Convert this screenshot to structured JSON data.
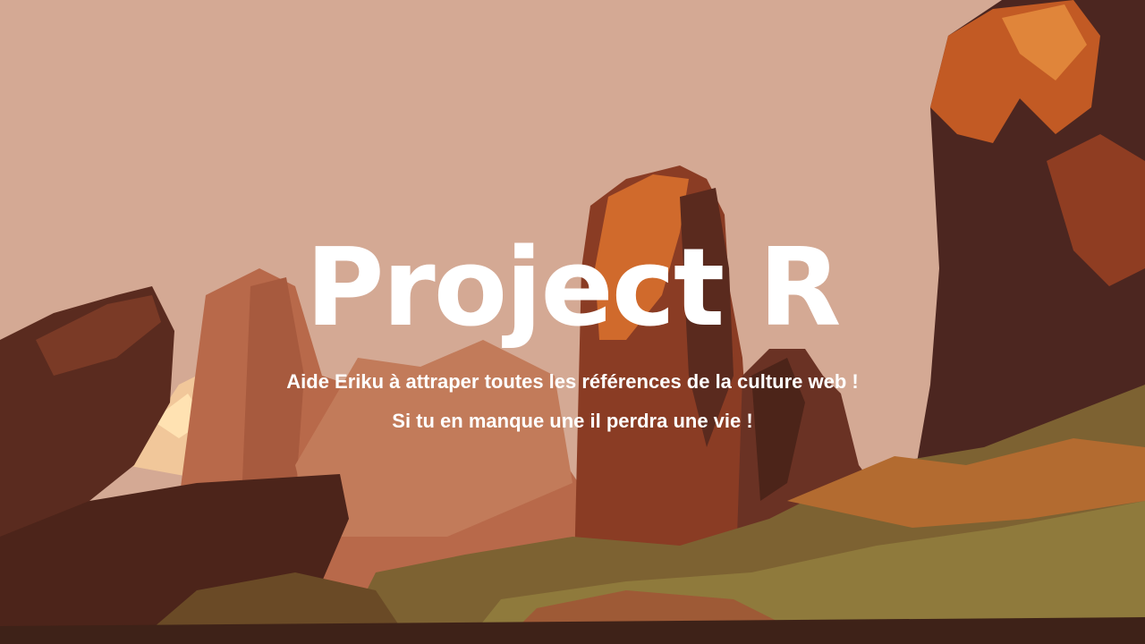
{
  "game": {
    "title": "Project R",
    "subtitle_lines": [
      "Aide Eriku à attraper toutes les références de la culture web !",
      "Si tu en manque une il perdra une vie !"
    ]
  },
  "colors": {
    "sky": "#d4a994",
    "text": "#ffffff",
    "rock_dark": "#4e2a20",
    "rock_mid": "#8a4a32",
    "rock_orange": "#c8612a",
    "ground": "#7a6a32"
  }
}
